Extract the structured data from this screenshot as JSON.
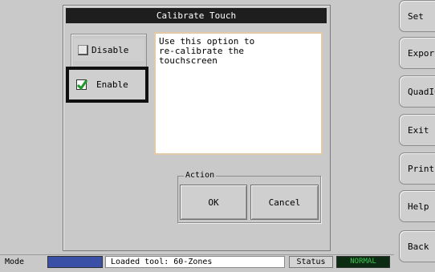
{
  "dialog": {
    "title": "Calibrate Touch",
    "options": {
      "disable_label": "Disable",
      "enable_label": "Enable",
      "selected": "Enable"
    },
    "description": "Use this option to\nre-calibrate the\ntouchscreen",
    "action_group_label": "Action",
    "ok_label": "OK",
    "cancel_label": "Cancel"
  },
  "side_buttons": [
    "Set",
    "Export",
    "QuadIO",
    "Exit",
    "Print",
    "Help",
    "Back"
  ],
  "status_bar": {
    "mode_label": "Mode",
    "tool_text": "Loaded tool: 60-Zones",
    "status_label": "Status",
    "status_value": "NORMAL"
  },
  "colors": {
    "title_bar": "#1e1e1e",
    "checkmark": "#1f9a2a",
    "mode_field": "#3a50a6",
    "status_value_bg": "#0d2a12",
    "status_value_text": "#3fc552"
  }
}
